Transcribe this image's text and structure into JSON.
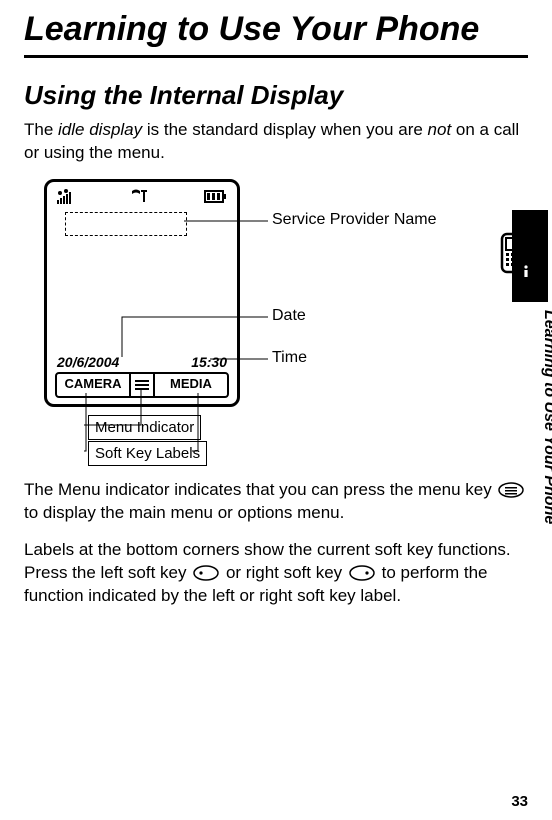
{
  "page": {
    "title": "Learning to Use Your Phone",
    "section_heading": "Using the Internal Display",
    "intro_p1_a": "The ",
    "intro_p1_em1": "idle display",
    "intro_p1_b": " is the standard display when you are ",
    "intro_p1_em2": "not",
    "intro_p1_c": " on a call or using the menu.",
    "p2": "The Menu indicator indicates that you can press the menu key ",
    "p2_b": " to display the main menu or options menu.",
    "p3_a": "Labels at the bottom corners show the current soft key functions. Press the left soft key ",
    "p3_b": " or right soft key ",
    "p3_c": " to perform the function indicated by the left or right soft key label.",
    "side_tab_text": "Learning to Use Your Phone",
    "page_number": "33"
  },
  "diagram": {
    "date": "20/6/2004",
    "time": "15:30",
    "softkey_left": "CAMERA",
    "softkey_right": "MEDIA",
    "callouts": {
      "service_provider": "Service Provider Name",
      "date": "Date",
      "time": "Time",
      "menu_indicator": "Menu Indicator",
      "soft_key_labels": "Soft Key Labels"
    }
  }
}
